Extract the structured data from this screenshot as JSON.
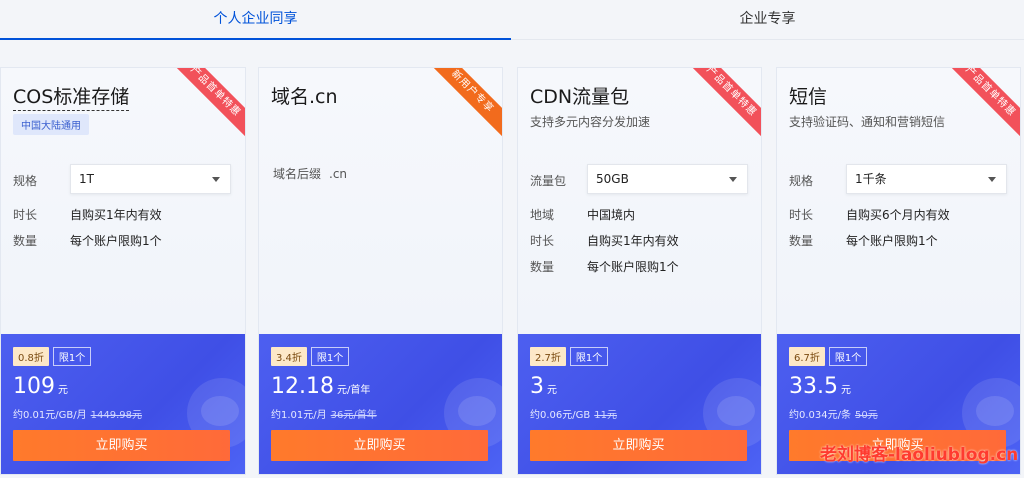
{
  "tabs": [
    {
      "label": "个人企业同享",
      "active": true
    },
    {
      "label": "企业专享",
      "active": false
    }
  ],
  "cards": [
    {
      "title": "COS标准存储",
      "ribbon": "产品首单特惠",
      "tag": "中国大陆通用",
      "select_label": "规格",
      "select_value": "1T",
      "rows": [
        {
          "k": "时长",
          "v": "自购买1年内有效"
        },
        {
          "k": "数量",
          "v": "每个账户限购1个"
        }
      ],
      "discount": "0.8折",
      "limit": "限1个",
      "price": "109",
      "price_unit": "元",
      "unit_price": "约0.01元/GB/月",
      "original": "1449.98元",
      "buy": "立即购买"
    },
    {
      "title": "域名.cn",
      "ribbon": "新用户专享",
      "suffix_label": "域名后缀",
      "suffix_value": ".cn",
      "discount": "3.4折",
      "limit": "限1个",
      "price": "12.18",
      "price_unit": "元/首年",
      "unit_price": "约1.01元/月",
      "original": "36元/首年",
      "buy": "立即购买"
    },
    {
      "title": "CDN流量包",
      "ribbon": "产品首单特惠",
      "sub": "支持多元内容分发加速",
      "select_label": "流量包",
      "select_value": "50GB",
      "rows": [
        {
          "k": "地域",
          "v": "中国境内"
        },
        {
          "k": "时长",
          "v": "自购买1年内有效"
        },
        {
          "k": "数量",
          "v": "每个账户限购1个"
        }
      ],
      "discount": "2.7折",
      "limit": "限1个",
      "price": "3",
      "price_unit": "元",
      "unit_price": "约0.06元/GB",
      "original": "11元",
      "buy": "立即购买"
    },
    {
      "title": "短信",
      "ribbon": "产品首单特惠",
      "sub": "支持验证码、通知和营销短信",
      "select_label": "规格",
      "select_value": "1千条",
      "rows": [
        {
          "k": "时长",
          "v": "自购买6个月内有效"
        },
        {
          "k": "数量",
          "v": "每个账户限购1个"
        }
      ],
      "discount": "6.7折",
      "limit": "限1个",
      "price": "33.5",
      "price_unit": "元",
      "unit_price": "约0.034元/条",
      "original": "50元",
      "buy": "立即购买"
    }
  ],
  "watermark": "老刘博客-laoliublog.cn",
  "colors": {
    "accent": "#0052d9",
    "ribbon_red": "#f2515a",
    "ribbon_orange": "#f26b1d",
    "panel_blue": "#4456ee",
    "buy_orange": "#ff7a2b"
  }
}
